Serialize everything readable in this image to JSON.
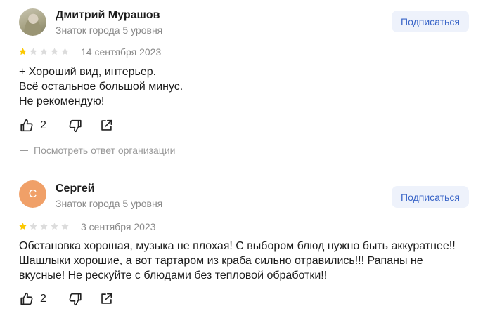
{
  "reviews": [
    {
      "author": "Дмитрий Мурашов",
      "status": "Знаток города 5 уровня",
      "subscribe_label": "Подписаться",
      "rating": 1,
      "max_rating": 5,
      "date": "14 сентября 2023",
      "text_lines": [
        "+ Хороший вид, интерьер.",
        "Всё остальное большой минус.",
        "Не рекомендую!"
      ],
      "likes": "2",
      "org_reply_label": "Посмотреть ответ организации"
    },
    {
      "author": "Сергей",
      "avatar_letter": "С",
      "status": "Знаток города 5 уровня",
      "subscribe_label": "Подписаться",
      "rating": 1,
      "max_rating": 5,
      "date": "3 сентября 2023",
      "text_lines": [
        "Обстановка хорошая, музыка не плохая! С выбором блюд нужно быть аккуратнее!!",
        "Шашлыки хорошие, а вот тартаром из краба сильно отравились!!! Рапаны не",
        "вкусные! Не рескуйте с блюдами без тепловой обработки!!"
      ],
      "likes": "2"
    }
  ],
  "colors": {
    "star_filled": "#fcc800",
    "star_empty": "#dcdcdc",
    "subscribe_bg": "#eef2fb",
    "subscribe_text": "#3b66c8",
    "avatar_letter_bg": "#f0a068",
    "muted_text": "#8a8a8a"
  },
  "icons": {
    "like": "thumbs-up-icon",
    "dislike": "thumbs-down-icon",
    "share": "share-icon",
    "star": "star-icon"
  }
}
